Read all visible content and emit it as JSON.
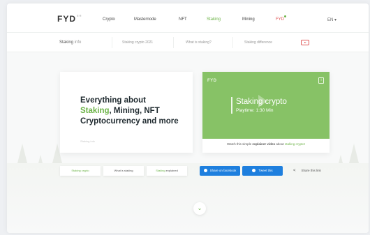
{
  "nav": {
    "logo": "FYD",
    "logo_sup": "ER",
    "items": [
      "Crypto",
      "Masternode",
      "NFT",
      "Staking",
      "Mining",
      "FYD"
    ],
    "active": "Staking",
    "lang": "EN ▾"
  },
  "subnav": {
    "breadcrumb_root": "Staking",
    "breadcrumb_sep": "info",
    "links": [
      "Staking crypto 2021",
      "What is staking?",
      "Staking difference"
    ]
  },
  "hero": {
    "headline_prefix": "Everything about",
    "headline_green": "Staking",
    "headline_rest1": ", Mining, NFT",
    "headline_line3": "Cryptocurrency and more",
    "faint_text": "Staking info"
  },
  "video": {
    "logo": "FYD",
    "title": "Staking crypto",
    "subtitle": "Playtime: 1:30 Min",
    "info_symbol": "i",
    "caption_prefix": "Watch this simple",
    "caption_bold": "explainer video",
    "caption_mid": "about",
    "caption_green": "staking crypto!"
  },
  "pills": [
    {
      "green": "Staking crypto",
      "rest": ""
    },
    {
      "green": "",
      "rest": "What is staking"
    },
    {
      "green": "Staking",
      "rest": "explained"
    }
  ],
  "share": {
    "facebook": "Share on facebook",
    "twitter": "Tweet this",
    "link": "Share this link"
  },
  "icons": {
    "chevron": "chevron-down-icon",
    "youtube": "youtube-icon",
    "share": "share-icon"
  },
  "colors": {
    "accent_green": "#6cb347",
    "video_green": "#87c266",
    "facebook_blue": "#1e7fde",
    "youtube_red": "#e05a5a"
  }
}
